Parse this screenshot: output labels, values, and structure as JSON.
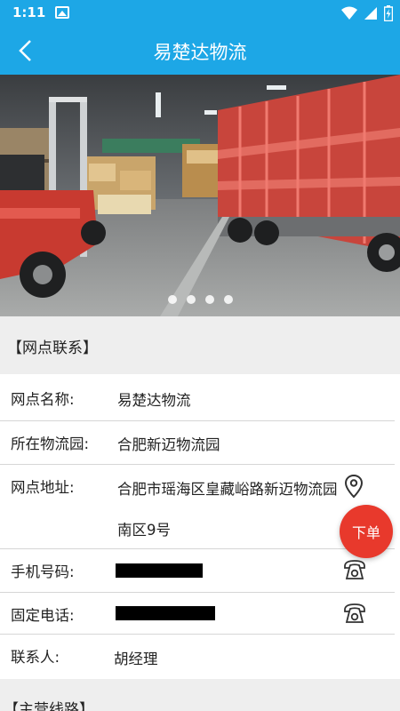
{
  "status_bar": {
    "time": "1:11"
  },
  "header": {
    "title": "易楚达物流"
  },
  "carousel": {
    "dot_count": 4
  },
  "section_contact": {
    "title": "【网点联系】"
  },
  "fields": [
    {
      "label": "网点名称:",
      "value": "易楚达物流"
    },
    {
      "label": "所在物流园:",
      "value": "合肥新迈物流园"
    },
    {
      "label": "网点地址:",
      "value_line1": "合肥市瑶海区皇藏峪路新迈物流园",
      "value_line2": "南区9号"
    },
    {
      "label": "手机号码:",
      "value": ""
    },
    {
      "label": "固定电话:",
      "value": ""
    },
    {
      "label": "联系人:",
      "value": "胡经理"
    }
  ],
  "section_routes": {
    "title": "【主营线路】"
  },
  "fab": {
    "label": "下单"
  },
  "colors": {
    "primary": "#1da7e6",
    "accent": "#e8392c",
    "section_bg": "#eeeeee"
  }
}
